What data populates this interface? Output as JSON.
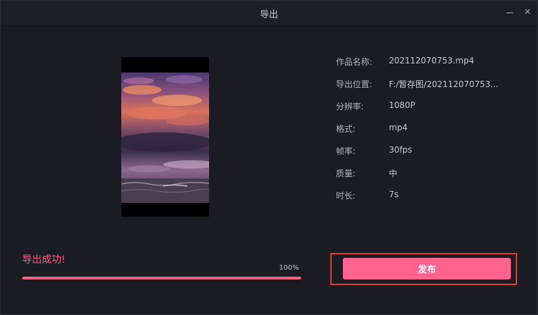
{
  "window": {
    "title": "导出"
  },
  "info": [
    {
      "label": "作品名称:",
      "value": "202112070753.mp4"
    },
    {
      "label": "导出位置:",
      "value": "F:/暂存图/202112070753..."
    },
    {
      "label": "分辨率:",
      "value": "1080P"
    },
    {
      "label": "格式:",
      "value": "mp4"
    },
    {
      "label": "帧率:",
      "value": "30fps"
    },
    {
      "label": "质量:",
      "value": "中"
    },
    {
      "label": "时长:",
      "value": "7s"
    }
  ],
  "status": {
    "message": "导出成功!",
    "percent_text": "100%",
    "progress": 1.0
  },
  "actions": {
    "publish_label": "发布"
  },
  "colors": {
    "accent": "#ff6285",
    "background": "#1b1b23",
    "highlight": "#e53935"
  },
  "icons": {
    "minimize": "minimize-icon",
    "close": "close-icon"
  }
}
